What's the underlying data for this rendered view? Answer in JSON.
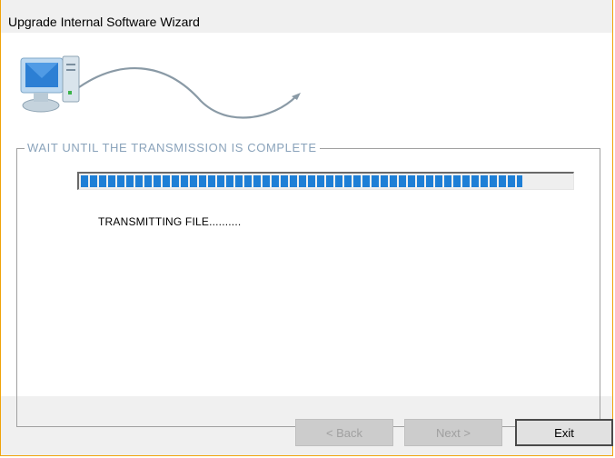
{
  "window": {
    "title": "Upgrade Internal Software Wizard"
  },
  "illustration": {
    "icon": "computer-cable-icon"
  },
  "group": {
    "legend": "WAIT UNTIL THE TRANSMISSION IS COMPLETE"
  },
  "progress": {
    "percent": 90
  },
  "status_text": "TRANSMITTING FILE..........",
  "buttons": {
    "back": "< Back",
    "next": "Next >",
    "exit": "Exit"
  },
  "colors": {
    "window_border": "#f0a30a",
    "progress_fill": "#1e7fd6",
    "legend_text": "#8aa3bb"
  }
}
